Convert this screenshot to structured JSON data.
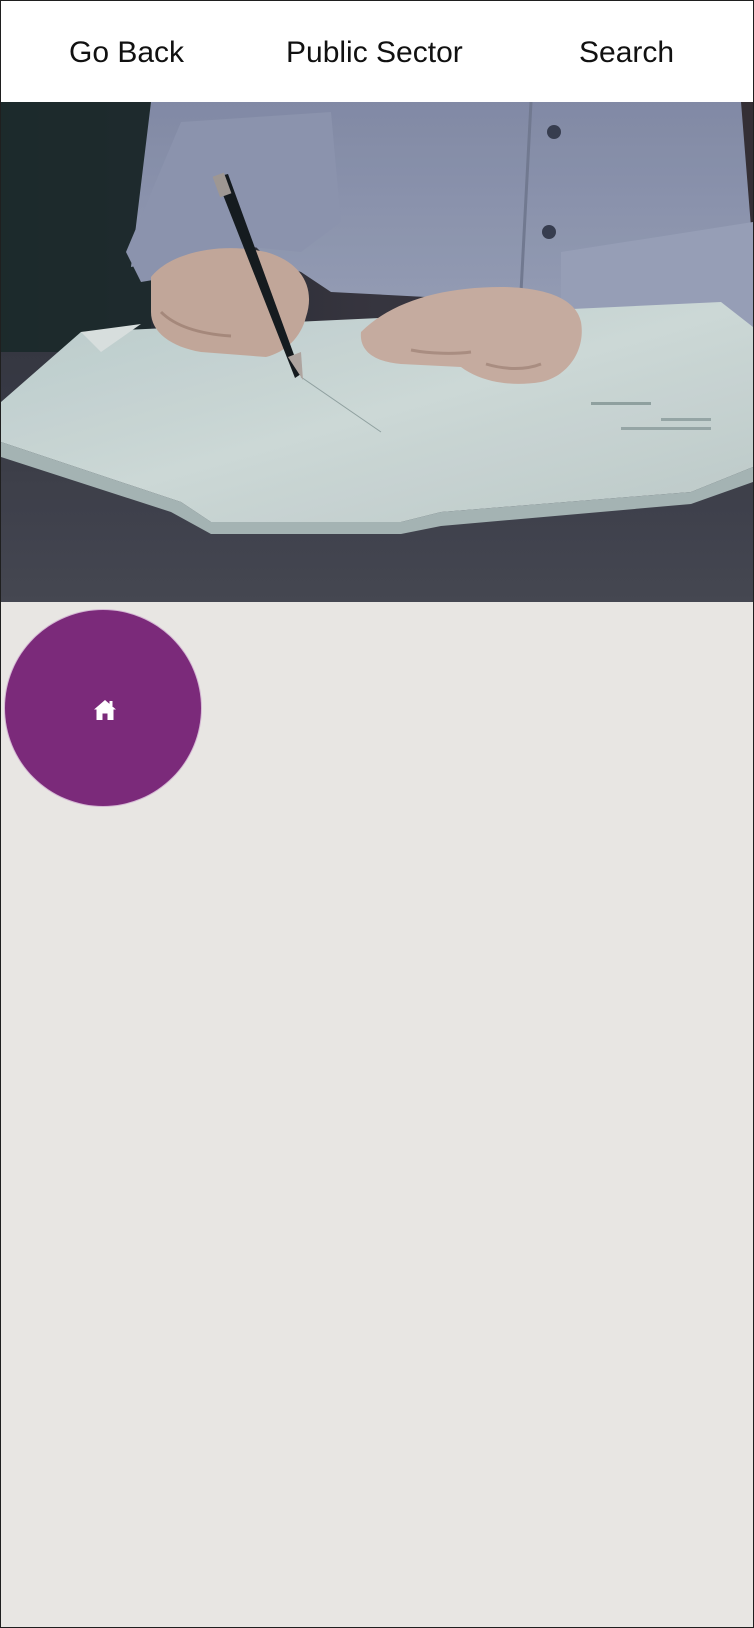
{
  "nav": {
    "back_label": "Go Back",
    "title": "Public Sector",
    "search_label": "Search"
  },
  "hero": {
    "image_subject": "hand-signing-document-photo"
  },
  "fab": {
    "icon": "home-icon"
  },
  "colors": {
    "accent": "#7b2a7a",
    "background": "#e8e6e3",
    "topbar": "#ffffff"
  }
}
